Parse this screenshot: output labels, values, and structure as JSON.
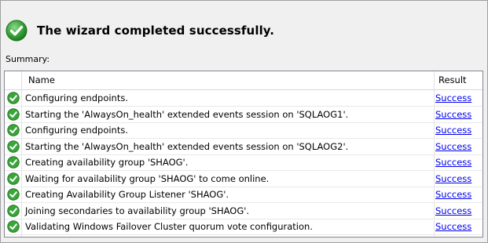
{
  "header": {
    "title": "The wizard completed successfully.",
    "icon": "success-check-icon"
  },
  "summary_label": "Summary:",
  "table": {
    "columns": [
      "Name",
      "Result"
    ],
    "rows": [
      {
        "name": "Configuring endpoints.",
        "result": "Success",
        "icon": "success-check-icon"
      },
      {
        "name": "Starting the 'AlwaysOn_health' extended events session on 'SQLAOG1'.",
        "result": "Success",
        "icon": "success-check-icon"
      },
      {
        "name": "Configuring endpoints.",
        "result": "Success",
        "icon": "success-check-icon"
      },
      {
        "name": "Starting the 'AlwaysOn_health' extended events session on 'SQLAOG2'.",
        "result": "Success",
        "icon": "success-check-icon"
      },
      {
        "name": "Creating availability group 'SHAOG'.",
        "result": "Success",
        "icon": "success-check-icon"
      },
      {
        "name": "Waiting for availability group 'SHAOG' to come online.",
        "result": "Success",
        "icon": "success-check-icon"
      },
      {
        "name": "Creating Availability Group Listener 'SHAOG'.",
        "result": "Success",
        "icon": "success-check-icon"
      },
      {
        "name": "Joining secondaries to availability group 'SHAOG'.",
        "result": "Success",
        "icon": "success-check-icon"
      },
      {
        "name": "Validating Windows Failover Cluster quorum vote configuration.",
        "result": "Success",
        "icon": "success-check-icon"
      }
    ]
  },
  "colors": {
    "success_green": "#3aa53a",
    "link": "#0000ee"
  }
}
